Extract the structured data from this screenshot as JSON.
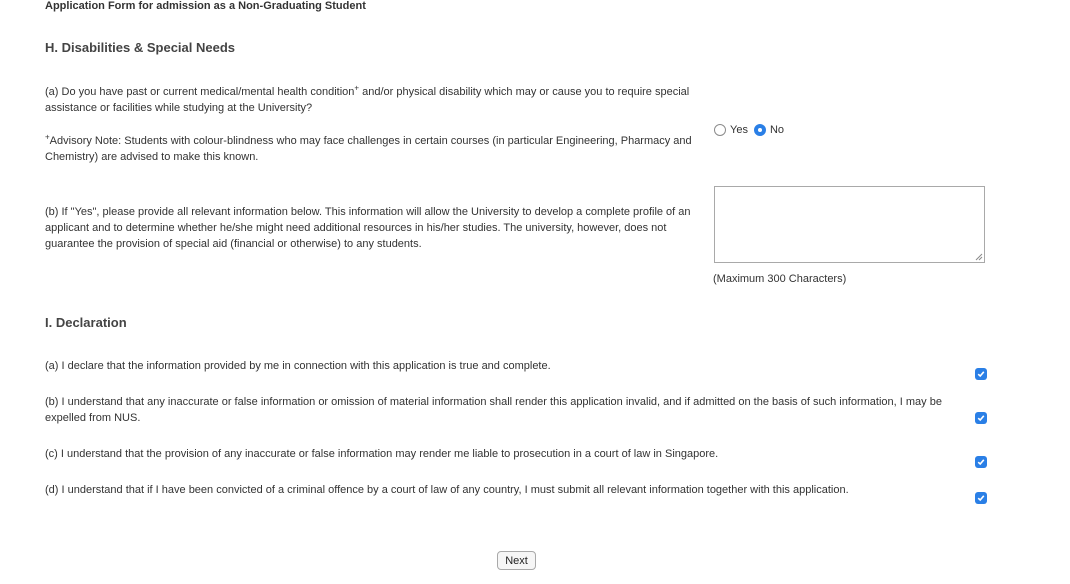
{
  "form_title": "Application Form for admission as a Non-Graduating Student",
  "section_h": {
    "heading": "H. Disabilities & Special Needs",
    "q_a_text_1": "(a) Do you have past or current medical/mental health condition",
    "q_a_sup": "+",
    "q_a_text_2": " and/or physical disability which may or cause you to require special assistance or facilities while studying at the University?",
    "advisory_sup": "+",
    "advisory_text": "Advisory Note: Students with colour-blindness who may face challenges in certain courses (in particular Engineering, Pharmacy and Chemistry) are advised to make this known.",
    "radio_yes_label": "Yes",
    "radio_no_label": "No",
    "selected": "No",
    "q_b_text": "(b) If \"Yes\", please provide all relevant information below. This information will allow the University to develop a complete profile of an applicant and to determine whether he/she might need additional resources in his/her studies. The university, however, does not guarantee the provision of special aid (financial or otherwise) to any students.",
    "textarea_value": "",
    "max_note": "(Maximum 300 Characters)"
  },
  "section_i": {
    "heading": "I. Declaration",
    "items": [
      {
        "text": "(a) I declare that the information provided by me in connection with this application is true and complete.",
        "checked": true
      },
      {
        "text": "(b) I understand that any inaccurate or false information or omission of material information shall render this application invalid, and if admitted on the basis of such information, I may be expelled from NUS.",
        "checked": true
      },
      {
        "text": "(c) I understand that the provision of any inaccurate or false information may render me liable to prosecution in a court of law in Singapore.",
        "checked": true
      },
      {
        "text": "(d) I understand that if I have been convicted of a criminal offence by a court of law of any country, I must submit all relevant information together with this application.",
        "checked": true
      }
    ]
  },
  "next_label": "Next",
  "colors": {
    "accent": "#2a7fe6",
    "text": "#333333",
    "border": "#a9a9a9"
  }
}
